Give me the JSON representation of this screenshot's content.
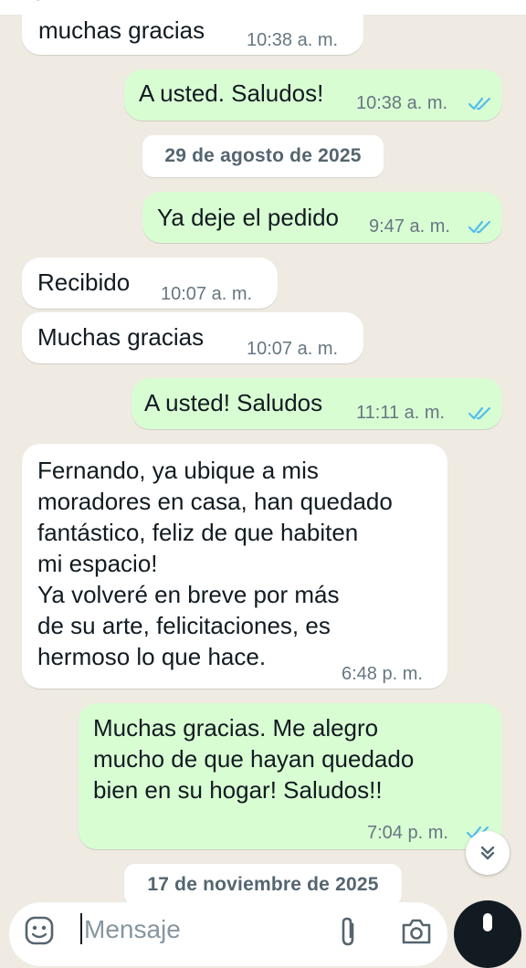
{
  "colors": {
    "background": "#efeae2",
    "incoming_bubble": "#ffffff",
    "outgoing_bubble": "#d9fdd3",
    "read_tick": "#53bdeb",
    "meta_text": "#667781"
  },
  "messages": [
    {
      "direction": "in",
      "text": "muchas gracias",
      "time": "10:38 a. m."
    },
    {
      "direction": "out",
      "text": "A usted. Saludos!",
      "time": "10:38 a. m.",
      "status": "read"
    },
    {
      "type": "date",
      "text": "29 de agosto de 2025"
    },
    {
      "direction": "out",
      "text": "Ya deje el pedido",
      "time": "9:47 a. m.",
      "status": "read"
    },
    {
      "direction": "in",
      "text": "Recibido",
      "time": "10:07 a. m."
    },
    {
      "direction": "in",
      "text": "Muchas gracias",
      "time": "10:07 a. m."
    },
    {
      "direction": "out",
      "text": "A usted! Saludos",
      "time": "11:11 a. m.",
      "status": "read"
    },
    {
      "direction": "in",
      "text": "Fernando, ya ubique a mis\nmoradores en casa, han quedado\nfantástico, feliz de que habiten\nmi espacio!\nYa volveré en breve por más\nde su arte, felicitaciones, es\nhermoso lo que hace.",
      "time": "6:48 p. m."
    },
    {
      "direction": "out",
      "text": "Muchas gracias. Me alegro\nmucho de que hayan quedado\nbien en su hogar! Saludos!!",
      "time": "7:04 p. m.",
      "status": "read"
    },
    {
      "type": "date",
      "text": "17 de noviembre de 2025"
    }
  ],
  "composer": {
    "placeholder": "Mensaje",
    "icons": [
      "sticker-icon",
      "attach-icon",
      "camera-icon",
      "mic-icon"
    ]
  },
  "scroll_down_icon": "double-chevron-down-icon"
}
